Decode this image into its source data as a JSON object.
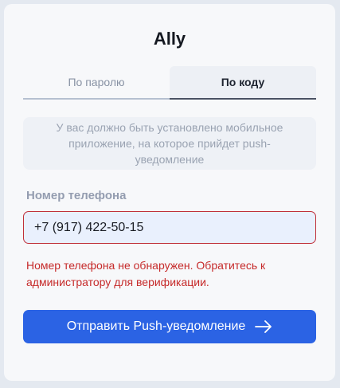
{
  "app": {
    "title": "Ally"
  },
  "tabs": [
    {
      "label": "По паролю",
      "active": false
    },
    {
      "label": "По коду",
      "active": true
    }
  ],
  "notice": {
    "text": "У вас должно быть установлено мобильное приложение, на которое прийдет push-уведомление"
  },
  "phone": {
    "label": "Номер телефона",
    "value": "+7 (917) 422-50-15"
  },
  "error": {
    "text": "Номер телефона не обнаружен. Обратитесь к администратору для верификации."
  },
  "submit": {
    "label": "Отправить Push-уведомление",
    "icon": "arrow-right-icon"
  },
  "colors": {
    "accent": "#2b63e4",
    "error": "#c62a2a",
    "background": "#e4e9f0",
    "card": "#f7f8fa"
  }
}
